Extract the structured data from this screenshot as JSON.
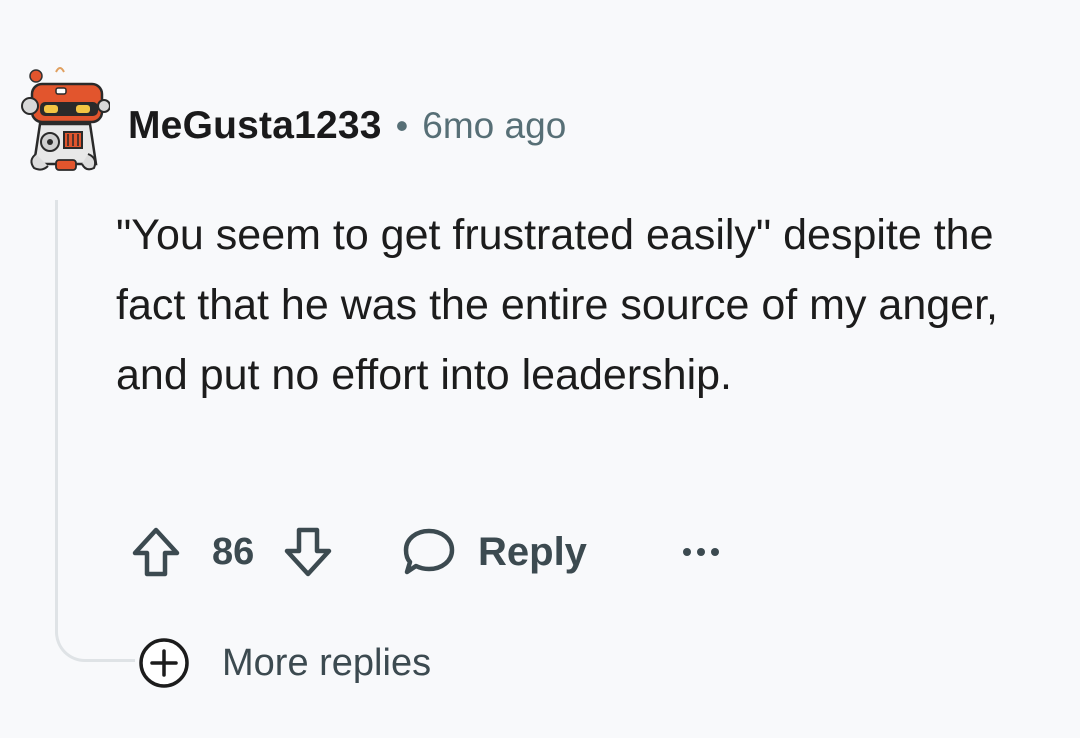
{
  "comment": {
    "author": "MeGusta1233",
    "separator": "•",
    "timestamp": "6mo ago",
    "body": "\"You seem to get frustrated easily\" despite the fact that he was the entire source of my anger, and put no effort into leadership.",
    "score": "86",
    "reply_label": "Reply",
    "more_replies_label": "More replies"
  },
  "icons": {
    "avatar": "robot-avatar-icon",
    "upvote": "arrow-up-icon",
    "downvote": "arrow-down-icon",
    "reply": "speech-bubble-icon",
    "overflow": "ellipsis-icon",
    "expand": "plus-circle-icon"
  },
  "colors": {
    "background": "#f8f9fb",
    "text": "#1c1c1c",
    "muted": "#576f76",
    "action": "#3c4a50",
    "thread_line": "#dfe3e6",
    "avatar_accent": "#e2552d"
  }
}
